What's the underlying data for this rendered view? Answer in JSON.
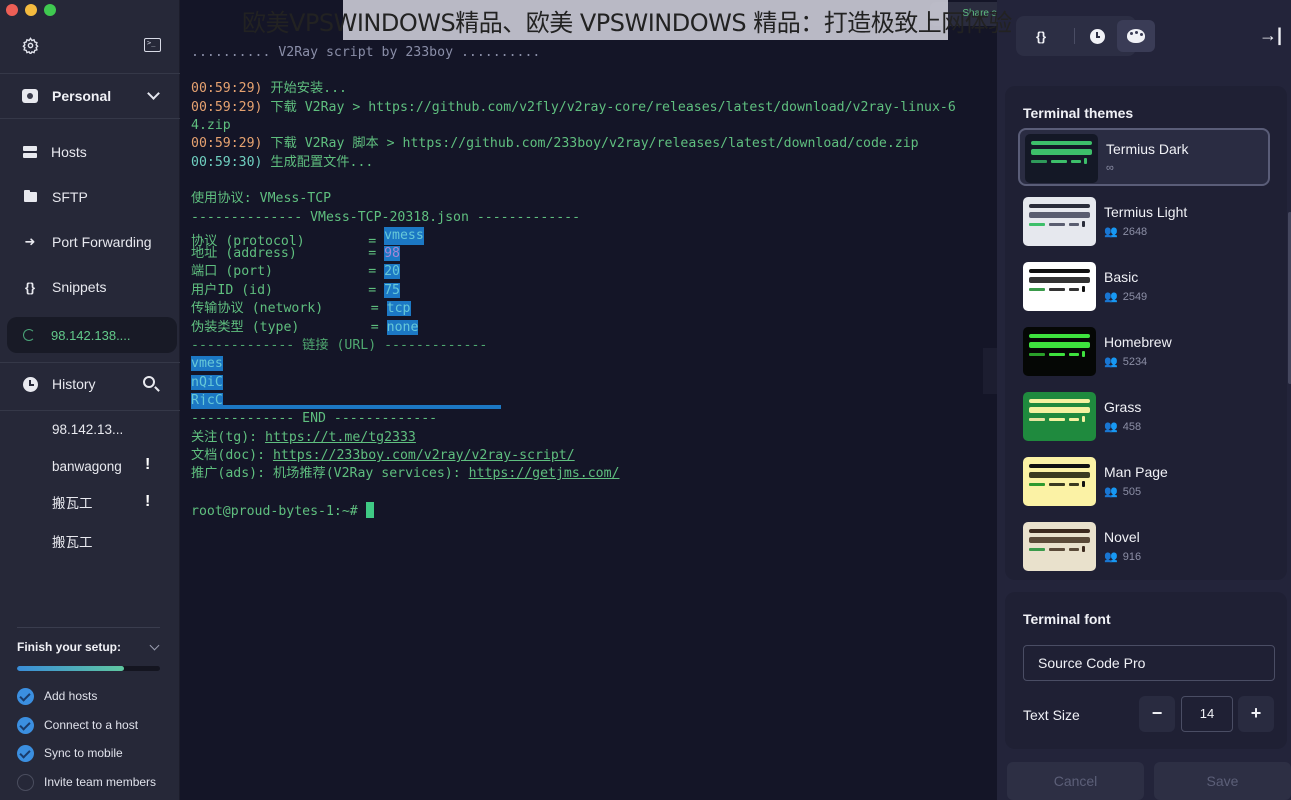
{
  "sidebar": {
    "vault": "Personal",
    "nav": [
      {
        "label": "Hosts",
        "icon": "hosts-icon"
      },
      {
        "label": "SFTP",
        "icon": "folder-icon"
      },
      {
        "label": "Port Forwarding",
        "icon": "port-forwarding-icon"
      },
      {
        "label": "Snippets",
        "icon": "snippets-icon"
      }
    ],
    "active_session": "98.142.138....",
    "history_label": "History",
    "history": [
      {
        "label": "98.142.13...",
        "warning": false
      },
      {
        "label": "banwagong",
        "warning": true
      },
      {
        "label": "搬瓦工",
        "warning": true
      },
      {
        "label": "搬瓦工",
        "warning": false
      }
    ],
    "warning_glyph": "!",
    "setup": {
      "title": "Finish your setup:",
      "progress_percent": 75,
      "items": [
        {
          "label": "Add hosts",
          "done": true
        },
        {
          "label": "Connect to a host",
          "done": true
        },
        {
          "label": "Sync to mobile",
          "done": true
        },
        {
          "label": "Invite team members",
          "done": false
        }
      ]
    }
  },
  "terminal": {
    "share_label": "Share session",
    "banner": ".......... V2Ray script by 233boy ..........",
    "log": [
      {
        "time": "00:59:29)",
        "text": " 开始安装..."
      },
      {
        "time": "00:59:29)",
        "text": " 下载 V2Ray > https://github.com/v2fly/v2ray-core/releases/latest/download/v2ray-linux-6"
      },
      {
        "time": "",
        "text": "4.zip"
      },
      {
        "time": "00:59:29)",
        "text": " 下载 V2Ray 脚本 > https://github.com/233boy/v2ray/releases/latest/download/code.zip"
      },
      {
        "time": "00:59:30)",
        "text": " 生成配置文件..."
      }
    ],
    "protocol_line": "使用协议: VMess-TCP",
    "json_header": "-------------- VMess-TCP-20318.json -------------",
    "config": [
      {
        "key": "协议 (protocol)        = ",
        "value": "vmess"
      },
      {
        "key": "地址 (address)         = ",
        "value": "98"
      },
      {
        "key": "端口 (port)            = ",
        "value": "20"
      },
      {
        "key": "用户ID (id)            = ",
        "value": "75"
      },
      {
        "key": "传输协议 (network)      = ",
        "value": "tcp"
      },
      {
        "key": "伪装类型 (type)         = ",
        "value": "none"
      }
    ],
    "url_header": "------------- 链接 (URL) -------------",
    "url_lines": [
      "vmes",
      "nQiC",
      "RjcC"
    ],
    "end_line": "------------- END -------------",
    "links": [
      {
        "prefix": "关注(tg): ",
        "mid": "",
        "url": "https://t.me/tg2333"
      },
      {
        "prefix": "文档(doc): ",
        "mid": "",
        "url": "https://233boy.com/v2ray/v2ray-script/"
      },
      {
        "prefix": "推广(ads): ",
        "mid": "机场推荐(V2Ray services): ",
        "url": "https://getjms.com/"
      }
    ],
    "prompt": "root@proud-bytes-1:~# "
  },
  "panel": {
    "tabs": [
      {
        "name": "snippets",
        "glyph": "{}"
      },
      {
        "name": "history",
        "glyph": ""
      },
      {
        "name": "themes",
        "glyph": ""
      }
    ],
    "collapse_glyph": "→|",
    "themes_title": "Terminal themes",
    "themes": [
      {
        "name": "Termius Dark",
        "count": "∞",
        "selected": true,
        "bg": "#141826",
        "b1": "#3dbf6a",
        "b2": "#3dbf6a",
        "b3": "#2f9a5a"
      },
      {
        "name": "Termius Light",
        "count": "2648",
        "selected": false,
        "bg": "#e6e8ee",
        "b1": "#2a2c3a",
        "b2": "#5a5d70",
        "b3": "#3dbf6a"
      },
      {
        "name": "Basic",
        "count": "2549",
        "selected": false,
        "bg": "#ffffff",
        "b1": "#111111",
        "b2": "#333333",
        "b3": "#3a9a4a"
      },
      {
        "name": "Homebrew",
        "count": "5234",
        "selected": false,
        "bg": "#050705",
        "b1": "#3ee23e",
        "b2": "#3ee23e",
        "b3": "#2aa02a"
      },
      {
        "name": "Grass",
        "count": "458",
        "selected": false,
        "bg": "#1f8a3e",
        "b1": "#f4f2a0",
        "b2": "#f4f2a0",
        "b3": "#e6e4a0"
      },
      {
        "name": "Man Page",
        "count": "505",
        "selected": false,
        "bg": "#fbf2a5",
        "b1": "#111111",
        "b2": "#3a3a20",
        "b3": "#2e9a2e"
      },
      {
        "name": "Novel",
        "count": "916",
        "selected": false,
        "bg": "#e9e1cc",
        "b1": "#3c2a1e",
        "b2": "#5a4a38",
        "b3": "#3a9a4a"
      }
    ],
    "font_title": "Terminal font",
    "font_value": "Source Code Pro",
    "text_size_label": "Text Size",
    "text_size": "14",
    "minus": "−",
    "plus": "+",
    "cancel": "Cancel",
    "save": "Save"
  },
  "watermark": "欧美VPSWINDOWS精品、欧美 VPSWINDOWS 精品：打造极致上网体验"
}
